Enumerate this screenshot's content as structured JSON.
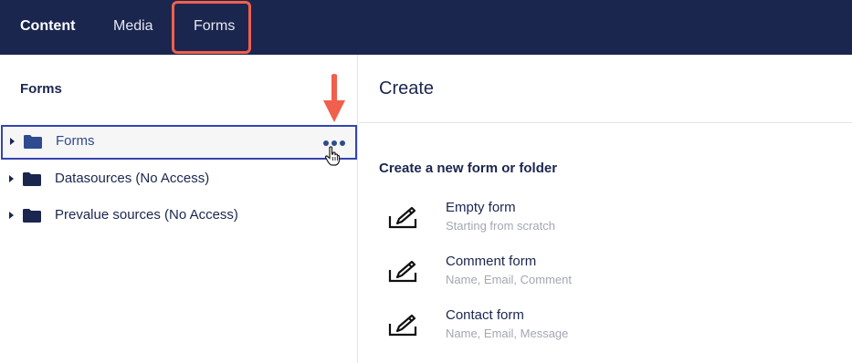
{
  "nav": {
    "items": [
      {
        "label": "Content"
      },
      {
        "label": "Media"
      },
      {
        "label": "Forms"
      }
    ]
  },
  "sidebar": {
    "title": "Forms",
    "tree": [
      {
        "label": "Forms",
        "icon": "folder-icon",
        "selected": true
      },
      {
        "label": "Datasources (No Access)",
        "icon": "folder-icon"
      },
      {
        "label": "Prevalue sources (No Access)",
        "icon": "folder-icon"
      }
    ]
  },
  "main": {
    "title": "Create",
    "section_title": "Create a new form or folder",
    "options": [
      {
        "label": "Empty form",
        "description": "Starting from scratch",
        "icon": "edit-form-icon"
      },
      {
        "label": "Comment form",
        "description": "Name, Email, Comment",
        "icon": "edit-form-icon"
      },
      {
        "label": "Contact form",
        "description": "Name, Email, Message",
        "icon": "edit-form-icon"
      }
    ]
  },
  "colors": {
    "topbar": "#1b264f",
    "highlight": "#f0604d",
    "selected_border": "#3544b1",
    "text_primary": "#1b264f",
    "text_muted": "#a4a7b2"
  }
}
